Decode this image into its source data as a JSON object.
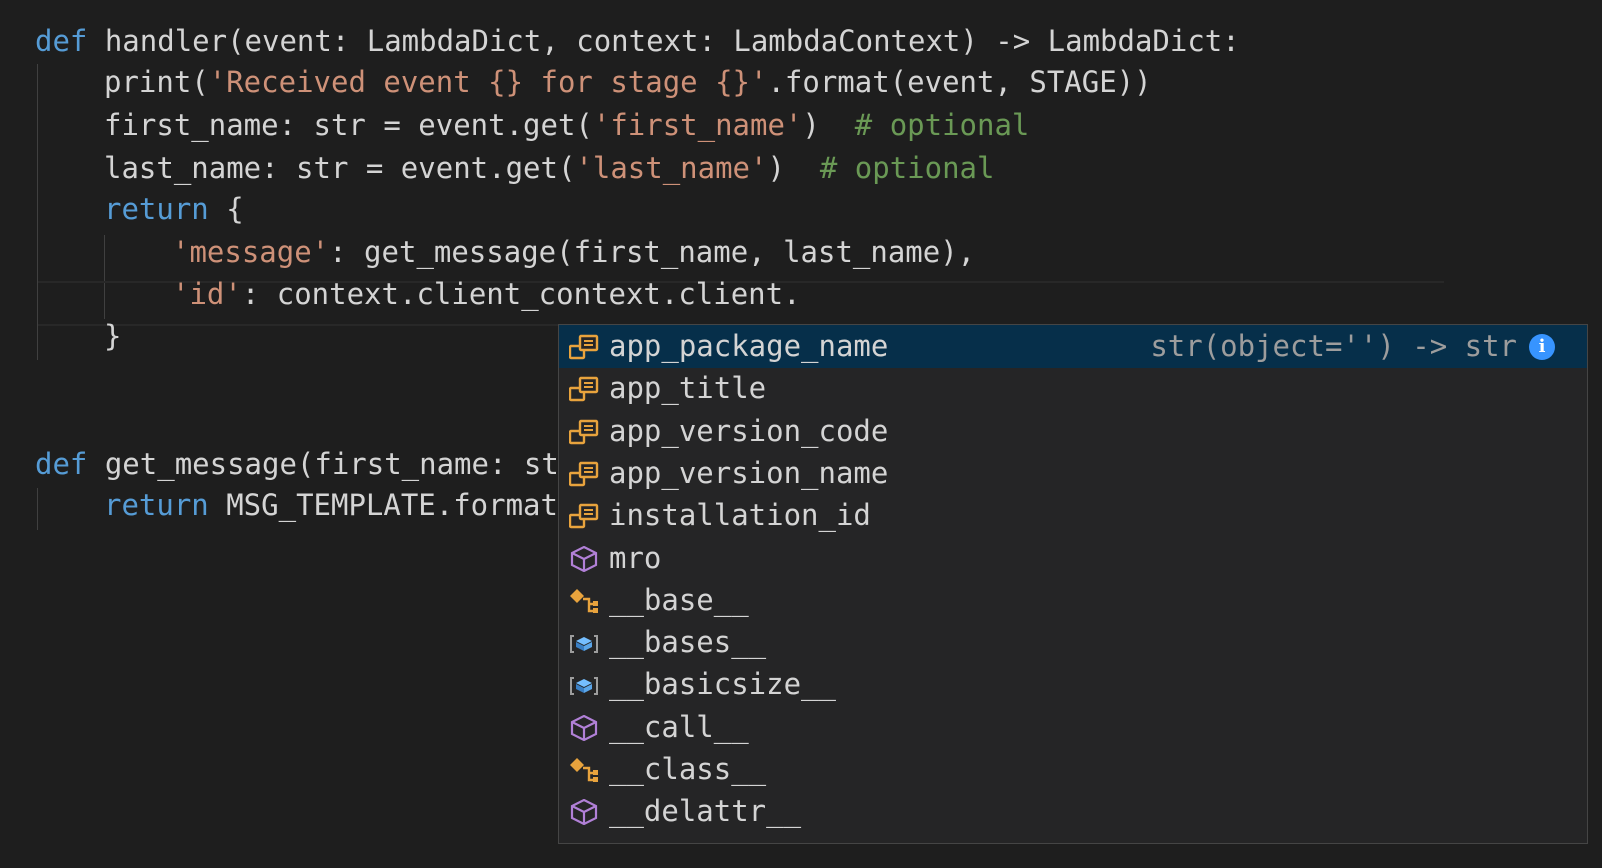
{
  "code": {
    "line1": {
      "kw": "def",
      "rest": " handler(event: LambdaDict, context: LambdaContext) -> LambdaDict:"
    },
    "line2": {
      "a": "print(",
      "s": "'Received event {} for stage {}'",
      "b": ".format(event, STAGE))"
    },
    "line3": {
      "a": "first_name: str = event.get(",
      "s": "'first_name'",
      "b": ")  ",
      "c": "# optional"
    },
    "line4": {
      "a": "last_name: str = event.get(",
      "s": "'last_name'",
      "b": ")  ",
      "c": "# optional"
    },
    "line5": {
      "kw": "return",
      "rest": " {"
    },
    "line6": {
      "s": "'message'",
      "rest": ": get_message(first_name, last_name),"
    },
    "line7": {
      "s": "'id'",
      "rest": ": context.client_context.client."
    },
    "line8": {
      "text": "}"
    },
    "line9": {
      "kw": "def",
      "rest": " get_message(first_name: st"
    },
    "line10": {
      "kw": "return",
      "rest": " MSG_TEMPLATE.format"
    }
  },
  "suggestions": {
    "selected_detail": "str(object='') -> str",
    "info_label": "i",
    "items": [
      {
        "label": "app_package_name",
        "icon": "field-icon"
      },
      {
        "label": "app_title",
        "icon": "field-icon"
      },
      {
        "label": "app_version_code",
        "icon": "field-icon"
      },
      {
        "label": "app_version_name",
        "icon": "field-icon"
      },
      {
        "label": "installation_id",
        "icon": "field-icon"
      },
      {
        "label": "mro",
        "icon": "method-icon"
      },
      {
        "label": "__base__",
        "icon": "class-icon"
      },
      {
        "label": "__bases__",
        "icon": "variable-icon"
      },
      {
        "label": "__basicsize__",
        "icon": "variable-icon"
      },
      {
        "label": "__call__",
        "icon": "method-icon"
      },
      {
        "label": "__class__",
        "icon": "class-icon"
      },
      {
        "label": "__delattr__",
        "icon": "method-icon"
      }
    ]
  },
  "colors": {
    "background": "#1e1e1e",
    "keyword": "#569cd6",
    "string": "#ce9178",
    "comment": "#6a9955",
    "selection": "#062f4a",
    "field_icon": "#e8a33d",
    "method_icon": "#b180d7",
    "variable_icon": "#75beff"
  }
}
